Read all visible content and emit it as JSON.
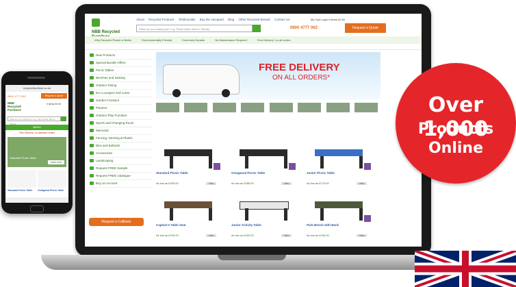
{
  "badge": {
    "line1": "Over 1,000",
    "line2": "Products",
    "line3": "Online"
  },
  "colors": {
    "badge": "#e4262b",
    "brand_green": "#4aa82e",
    "accent_orange": "#e46e1d",
    "flag_blue": "#012169",
    "flag_red": "#c8102e"
  },
  "laptop": {
    "logo": "NBB Recycled Furniture",
    "top_links": [
      "About",
      "Recycled Products",
      "Testimonials",
      "Buy the Jacquard",
      "Blog",
      "Other Recycled Brands",
      "Contact Us"
    ],
    "cart": "My Cart  Login  0 items  £0.00",
    "search_placeholder": "What are you looking for? e.g. Picnic table, Bench, Planter",
    "phone": "0800 4777 062",
    "quote_button": "Request a Quote",
    "usp": [
      "Why Recycled Plastic is Better",
      "Environmentally Friendly",
      "Extremely Durable",
      "No Maintenance Required",
      "Free Delivery* on all orders"
    ],
    "sidebar": [
      "New Products",
      "Special Bundle Offers",
      "Picnic Tables",
      "Benches and Seating",
      "Outdoor Dining",
      "Eco Loungers and Lunar",
      "Garden Furniture",
      "Planters",
      "Outdoor Play Furniture",
      "Sports and Changing Room",
      "Memorial",
      "Fencing, Decking & Planks",
      "Bins and Bollards",
      "Accessories",
      "Landscaping",
      "Request FREE Sample",
      "Request FREE catalogue",
      "Buy on Account"
    ],
    "callback_button": "Request a Callback",
    "banner_line1": "FREE DELIVERY",
    "banner_line2": "ON ALL ORDERS*",
    "products": [
      {
        "name": "Standard Picnic Table",
        "price": "As low as £205.00",
        "button": "View"
      },
      {
        "name": "Octagonal Picnic Table",
        "price": "As low as £385.00",
        "button": "View"
      },
      {
        "name": "Junior Picnic Table",
        "price": "As low as £175.00",
        "button": "View"
      },
      {
        "name": "Captain's Table Seat",
        "price": "As low as £199.00",
        "button": "View"
      },
      {
        "name": "Junior Activity Table",
        "price": "As low as £203.00",
        "button": "View"
      },
      {
        "name": "Park Bench with Back",
        "price": "As low as £240.00",
        "button": "View"
      }
    ]
  },
  "phone": {
    "url": "recycledfurniture.co.uk",
    "phone_number": "0800 4777 062",
    "quote_button": "Request a Quote",
    "logo": "NBB Recycled Furniture",
    "cart": "0 items £0.00",
    "search_placeholder": "What are you looking for? e.g. Picnic table, Bench, Planter",
    "menu": "MENU",
    "free_delivery": "Free Delivery* on standard orders",
    "hero_label": "Standard Picnic Table",
    "shop_now": "SHOP NOW",
    "product1": "Standard Picnic Table",
    "product2": "Octagonal Picnic Table"
  }
}
